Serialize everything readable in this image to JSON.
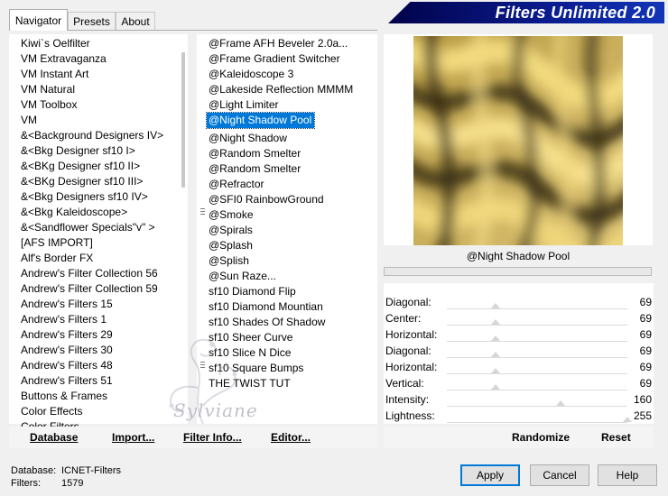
{
  "tabs": [
    "Navigator",
    "Presets",
    "About"
  ],
  "banner": "Filters Unlimited 2.0",
  "categories": [
    "Kiwi`s Oelfilter",
    "VM Extravaganza",
    "VM Instant Art",
    "VM Natural",
    "VM Toolbox",
    "VM",
    "&<Background Designers IV>",
    "&<Bkg Designer sf10 I>",
    "&<BKg Designer sf10 II>",
    "&<BKg Designer sf10 III>",
    "&<Bkg Designers sf10 IV>",
    "&<Bkg Kaleidoscope>",
    "&<Sandflower Specials\"v\" >",
    "[AFS IMPORT]",
    "Alf's Border FX",
    "Andrew's Filter Collection 56",
    "Andrew's Filter Collection 59",
    "Andrew's Filters 15",
    "Andrew's Filters 1",
    "Andrew's Filters 29",
    "Andrew's Filters 30",
    "Andrew's Filters 48",
    "Andrew's Filters 51",
    "Buttons & Frames",
    "Color Effects",
    "Color Filters"
  ],
  "filters": [
    "@Frame AFH Beveler 2.0a...",
    "@Frame Gradient Switcher",
    "@Kaleidoscope 3",
    "@Lakeside Reflection MMMM",
    "@Light Limiter",
    "@Night Shadow Pool",
    "@Night Shadow",
    "@Random Smelter",
    "@Random Smelter",
    "@Refractor",
    "@SFI0 RainbowGround",
    "@Smoke",
    "@Spirals",
    "@Splash",
    "@Splish",
    "@Sun Raze...",
    "sf10 Diamond Flip",
    "sf10 Diamond Mountian",
    "sf10 Shades Of Shadow",
    "sf10 Sheer Curve",
    "sf10 Slice N Dice",
    "sf10 Square Bumps",
    "THE TWIST TUT"
  ],
  "selected_filter": "@Night Shadow Pool",
  "params": [
    {
      "label": "Diagonal:",
      "value": "69",
      "fraction": 0.27
    },
    {
      "label": "Center:",
      "value": "69",
      "fraction": 0.27
    },
    {
      "label": "Horizontal:",
      "value": "69",
      "fraction": 0.27
    },
    {
      "label": "Diagonal:",
      "value": "69",
      "fraction": 0.27
    },
    {
      "label": "Horizontal:",
      "value": "69",
      "fraction": 0.27
    },
    {
      "label": "Vertical:",
      "value": "69",
      "fraction": 0.27
    },
    {
      "label": "Intensity:",
      "value": "160",
      "fraction": 0.63
    },
    {
      "label": "Lightness:",
      "value": "255",
      "fraction": 1.0
    }
  ],
  "buttons": {
    "database": "Database",
    "import": "Import...",
    "filter_info": "Filter Info...",
    "editor": "Editor...",
    "randomize": "Randomize",
    "reset": "Reset",
    "apply": "Apply",
    "cancel": "Cancel",
    "help": "Help"
  },
  "status": {
    "db_label": "Database:",
    "db_value": "ICNET-Filters",
    "filters_label": "Filters:",
    "filters_value": "1579"
  },
  "watermark": "Sylviane",
  "colors": {
    "banner": "#0a1c90",
    "selection": "#0078d7",
    "preview_gold": "#f0d67a",
    "preview_dark": "#3f3517"
  }
}
